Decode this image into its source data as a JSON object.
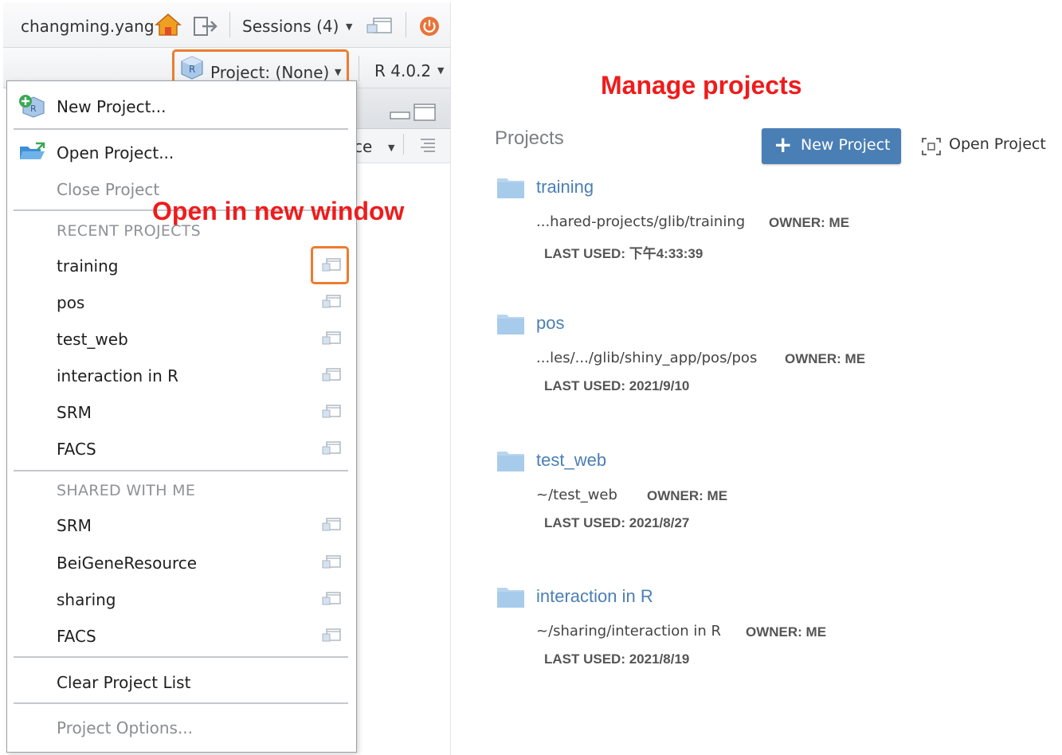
{
  "toolbar": {
    "username": "changming.yang",
    "sessions_label": "Sessions (4)",
    "project_label": "Project: (None)",
    "r_version": "R 4.0.2"
  },
  "pane": {
    "partial_text": "ce"
  },
  "menu": {
    "new_project": "New Project...",
    "open_project": "Open Project...",
    "close_project": "Close Project",
    "recent_header": "RECENT PROJECTS",
    "recent": [
      "training",
      "pos",
      "test_web",
      "interaction in R",
      "SRM",
      "FACS"
    ],
    "shared_header": "SHARED WITH ME",
    "shared": [
      "SRM",
      "BeiGeneResource",
      "sharing",
      "FACS"
    ],
    "clear_list": "Clear Project List",
    "options": "Project Options..."
  },
  "annotations": {
    "open_new_window": "Open in new window",
    "manage_projects": "Manage projects"
  },
  "projects_panel": {
    "title": "Projects",
    "new_project_button": "New Project",
    "open_project_link": "Open Project",
    "items": [
      {
        "name": "training",
        "path": "...hared-projects/glib/training",
        "owner": "OWNER: ME",
        "last_used": "LAST USED: 下午4:33:39"
      },
      {
        "name": "pos",
        "path": "...les/.../glib/shiny_app/pos/pos",
        "owner": "OWNER: ME",
        "last_used": "LAST USED: 2021/9/10"
      },
      {
        "name": "test_web",
        "path": "~/test_web",
        "owner": "OWNER: ME",
        "last_used": "LAST USED: 2021/8/27"
      },
      {
        "name": "interaction in R",
        "path": "~/sharing/interaction in R",
        "owner": "OWNER: ME",
        "last_used": "LAST USED: 2021/8/19"
      }
    ]
  },
  "colors": {
    "accent_blue": "#4a7fb5",
    "highlight_orange": "#ec7c30",
    "annotation_red": "#ee1c1c",
    "power_orange": "#e8743b"
  },
  "icons": {
    "home": "home-icon",
    "signout": "sign-out-icon",
    "new_window": "new-window-icon",
    "power": "power-icon",
    "r_cube": "r-project-icon",
    "folder": "folder-icon"
  }
}
